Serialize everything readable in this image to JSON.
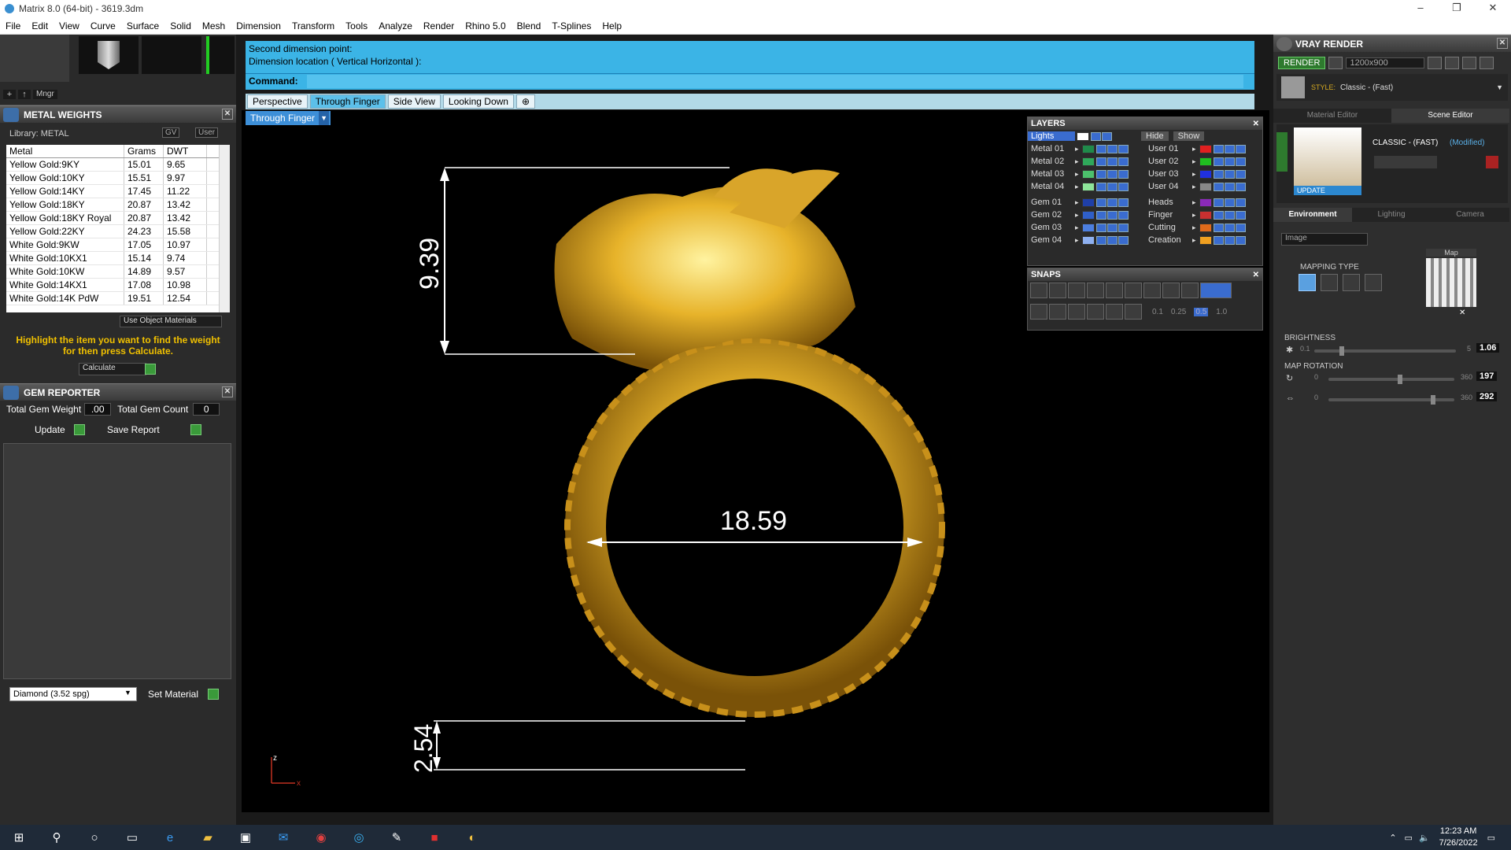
{
  "window": {
    "title": "Matrix 8.0 (64-bit) - 3619.3dm",
    "controls": [
      "–",
      "❐",
      "✕"
    ]
  },
  "menu": [
    "File",
    "Edit",
    "View",
    "Curve",
    "Surface",
    "Solid",
    "Mesh",
    "Dimension",
    "Transform",
    "Tools",
    "Analyze",
    "Render",
    "Rhino 5.0",
    "Blend",
    "T-Splines",
    "Help"
  ],
  "left_toolbar": {
    "mngr": "Mngr"
  },
  "metal_weights": {
    "title": "METAL WEIGHTS",
    "library_label": "Library: METAL",
    "gv": "GV",
    "user": "User",
    "columns": [
      "Metal",
      "Grams",
      "DWT"
    ],
    "rows": [
      [
        "Yellow Gold:9KY",
        "15.01",
        "9.65"
      ],
      [
        "Yellow Gold:10KY",
        "15.51",
        "9.97"
      ],
      [
        "Yellow Gold:14KY",
        "17.45",
        "11.22"
      ],
      [
        "Yellow Gold:18KY",
        "20.87",
        "13.42"
      ],
      [
        "Yellow Gold:18KY Royal",
        "20.87",
        "13.42"
      ],
      [
        "Yellow Gold:22KY",
        "24.23",
        "15.58"
      ],
      [
        "White Gold:9KW",
        "17.05",
        "10.97"
      ],
      [
        "White Gold:10KX1",
        "15.14",
        "9.74"
      ],
      [
        "White Gold:10KW",
        "14.89",
        "9.57"
      ],
      [
        "White Gold:14KX1",
        "17.08",
        "10.98"
      ],
      [
        "White Gold:14K PdW",
        "19.51",
        "12.54"
      ]
    ],
    "use_object_materials": "Use Object Materials",
    "note": "Highlight the item you want to find the weight for then press Calculate.",
    "calculate": "Calculate"
  },
  "gem_reporter": {
    "title": "GEM REPORTER",
    "total_weight_label": "Total Gem Weight",
    "total_weight_value": ".00",
    "total_count_label": "Total Gem Count",
    "total_count_value": "0",
    "update": "Update",
    "save_report": "Save Report",
    "material_select": "Diamond   (3.52 spg)",
    "set_material": "Set Material"
  },
  "command": {
    "line1": "Second dimension point:",
    "line2": "Dimension location ( Vertical  Horizontal ):",
    "label": "Command:"
  },
  "viewport_tabs": [
    "Perspective",
    "Through Finger",
    "Side View",
    "Looking Down"
  ],
  "active_tab": "Through Finger",
  "viewport_label": "Through Finger",
  "dimensions": {
    "height": "9.39",
    "diameter": "18.59",
    "thickness": "2.54"
  },
  "axis": {
    "z": "z",
    "x": "x"
  },
  "layers": {
    "title": "LAYERS",
    "lights": "Lights",
    "hide": "Hide",
    "show": "Show",
    "left": [
      {
        "name": "Metal 01",
        "color": "#1f8a4a"
      },
      {
        "name": "Metal 02",
        "color": "#2fa85a"
      },
      {
        "name": "Metal 03",
        "color": "#4cc06c"
      },
      {
        "name": "Metal 04",
        "color": "#8ee59a"
      },
      {
        "name": "Gem 01",
        "color": "#1f3fa8"
      },
      {
        "name": "Gem 02",
        "color": "#2f5fc8"
      },
      {
        "name": "Gem 03",
        "color": "#4c7fe0"
      },
      {
        "name": "Gem 04",
        "color": "#8eb0f0"
      }
    ],
    "right": [
      {
        "name": "User 01",
        "color": "#e02020"
      },
      {
        "name": "User 02",
        "color": "#20c020"
      },
      {
        "name": "User 03",
        "color": "#2030e0"
      },
      {
        "name": "User 04",
        "color": "#888888"
      },
      {
        "name": "Heads",
        "color": "#8a2ab8"
      },
      {
        "name": "Finger",
        "color": "#c83030"
      },
      {
        "name": "Cutting",
        "color": "#e06a1a"
      },
      {
        "name": "Creation",
        "color": "#f0a020"
      }
    ]
  },
  "snaps": {
    "title": "SNAPS",
    "values": [
      "0.1",
      "0.25",
      "0.5",
      "1.0"
    ]
  },
  "vray": {
    "title": "VRAY RENDER",
    "render": "RENDER",
    "resolution": "1200x900",
    "style_label": "STYLE:",
    "style_value": "Classic - (Fast)",
    "tab_material_editor": "Material Editor",
    "tab_scene_editor": "Scene Editor",
    "preset_name": "CLASSIC - (FAST)",
    "modified": "(Modified)",
    "update": "UPDATE",
    "subtabs": [
      "Environment",
      "Lighting",
      "Camera"
    ],
    "env_select": "Image",
    "mapping_type": "MAPPING TYPE",
    "map_label": "Map",
    "brightness_label": "BRIGHTNESS",
    "brightness_min": "0.1",
    "brightness_max": "5",
    "brightness_value": "1.06",
    "brightness_fraction": 0.18,
    "map_rotation_label": "MAP ROTATION",
    "rot_min": "0",
    "rot_max": "360",
    "rot1_value": "197",
    "rot1_fraction": 0.547,
    "rot2_value": "292",
    "rot2_fraction": 0.811
  },
  "taskbar": {
    "time": "12:23 AM",
    "date": "7/26/2022"
  }
}
